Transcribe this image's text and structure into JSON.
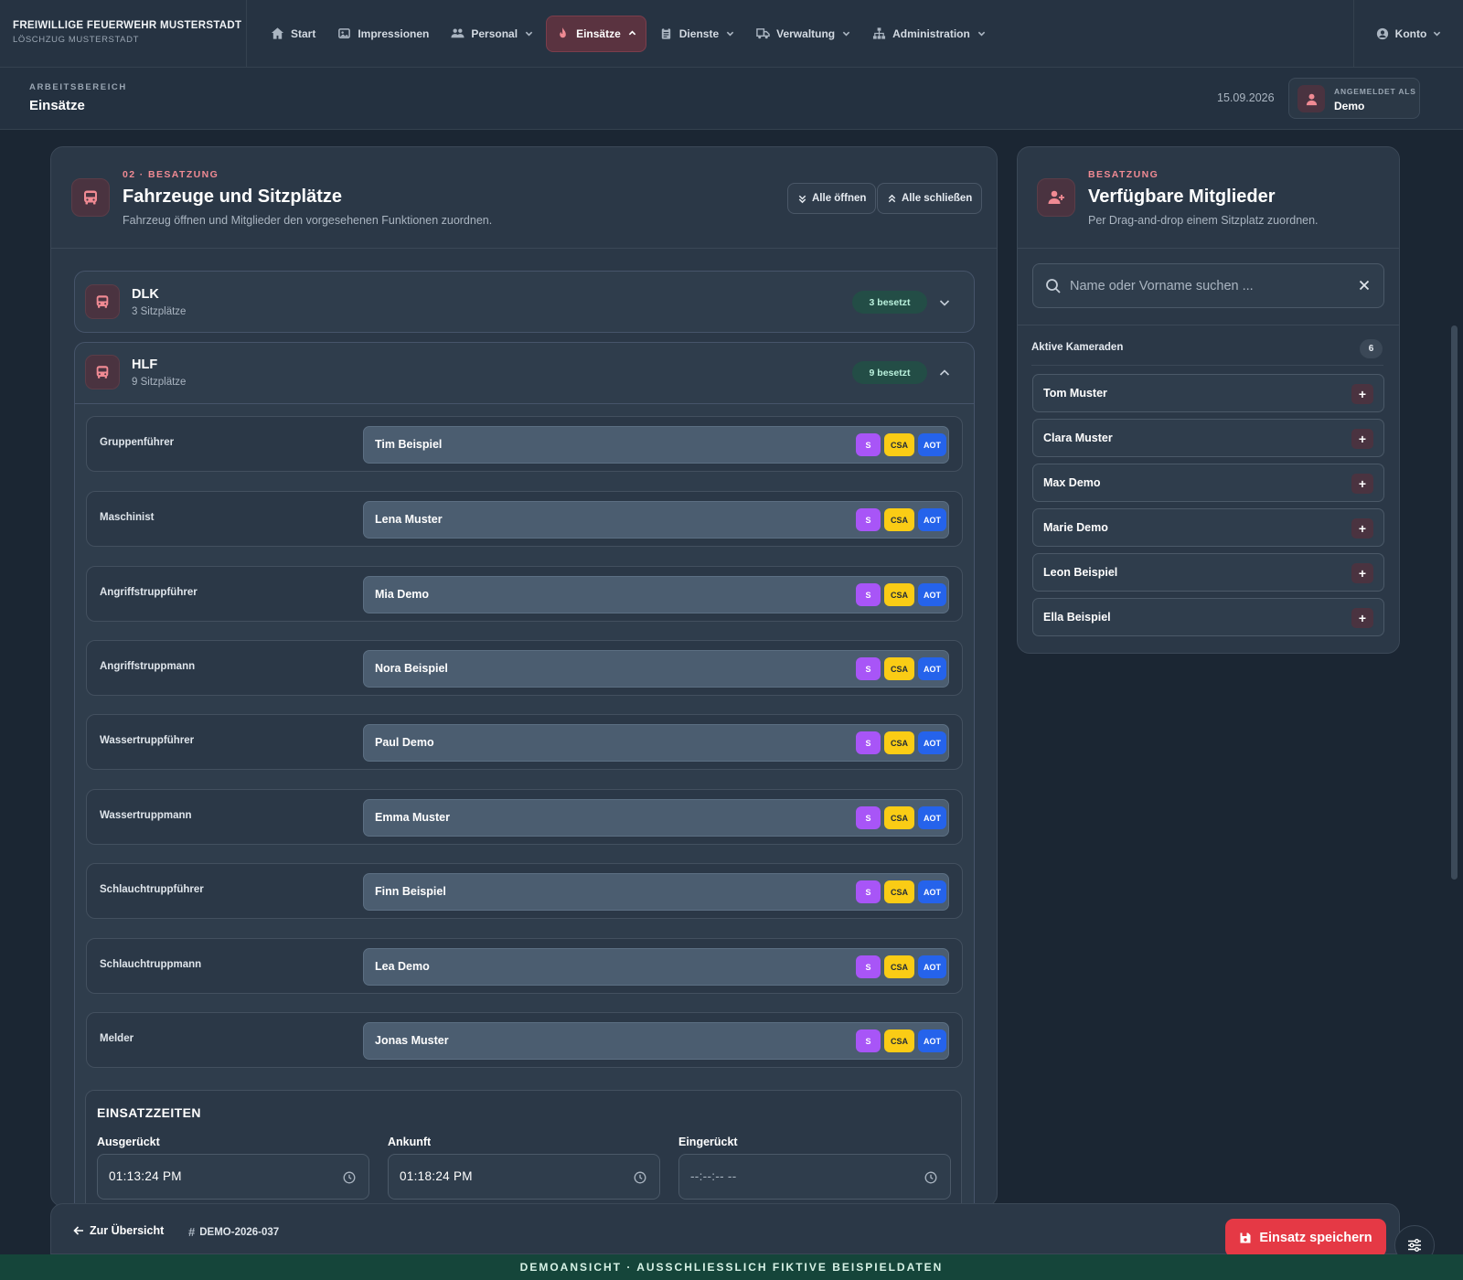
{
  "brand": {
    "title": "FREIWILLIGE FEUERWEHR MUSTERSTADT",
    "subtitle": "LÖSCHZUG MUSTERSTADT"
  },
  "nav": {
    "items": [
      {
        "label": "Start",
        "icon": "home-icon"
      },
      {
        "label": "Impressionen",
        "icon": "image-icon"
      },
      {
        "label": "Personal",
        "icon": "users-icon"
      },
      {
        "label": "Einsätze",
        "icon": "flame-icon"
      },
      {
        "label": "Dienste",
        "icon": "clipboard-icon"
      },
      {
        "label": "Verwaltung",
        "icon": "truck-icon"
      },
      {
        "label": "Administration",
        "icon": "network-icon"
      }
    ],
    "active": "Einsätze",
    "account_label": "Konto"
  },
  "subheader": {
    "kicker": "ARBEITSBEREICH",
    "title": "Einsätze",
    "date": "15.09.2026",
    "user_label": "ANGEMELDET ALS",
    "user_name": "Demo"
  },
  "vehicles_panel": {
    "kicker": "02 · BESATZUNG",
    "title": "Fahrzeuge und Sitzplätze",
    "subtitle": "Fahrzeug öffnen und Mitglieder den vorgesehenen Funktionen zuordnen.",
    "open_all": "Alle öffnen",
    "close_all": "Alle schließen",
    "vehicles": [
      {
        "name": "DLK",
        "seats": "3 Sitzplätze",
        "badge": "3 besetzt",
        "expanded": false
      },
      {
        "name": "HLF",
        "seats": "9 Sitzplätze",
        "badge": "9 besetzt",
        "expanded": true
      }
    ],
    "tags": {
      "s": "S",
      "csa": "CSA",
      "aot": "AOT"
    },
    "assignments": [
      {
        "role": "Gruppenführer",
        "person": "Tim Beispiel"
      },
      {
        "role": "Maschinist",
        "person": "Lena Muster"
      },
      {
        "role": "Angriffstruppführer",
        "person": "Mia Demo"
      },
      {
        "role": "Angriffstruppmann",
        "person": "Nora Beispiel"
      },
      {
        "role": "Wassertruppführer",
        "person": "Paul Demo"
      },
      {
        "role": "Wassertruppmann",
        "person": "Emma Muster"
      },
      {
        "role": "Schlauchtruppführer",
        "person": "Finn Beispiel"
      },
      {
        "role": "Schlauchtruppmann",
        "person": "Lea Demo"
      },
      {
        "role": "Melder",
        "person": "Jonas Muster"
      }
    ],
    "times": {
      "title": "EINSATZZEITEN",
      "fields": [
        {
          "label": "Ausgerückt",
          "value": "01:13:24 PM"
        },
        {
          "label": "Ankunft",
          "value": "01:18:24 PM"
        },
        {
          "label": "Eingerückt",
          "value": "--:--:-- --"
        }
      ]
    }
  },
  "members_panel": {
    "kicker": "BESATZUNG",
    "title": "Verfügbare Mitglieder",
    "subtitle": "Per Drag-and-drop einem Sitzplatz zuordnen.",
    "search_placeholder": "Name oder Vorname suchen ...",
    "active_label": "Aktive Kameraden",
    "active_count": "6",
    "add_symbol": "+",
    "members": [
      "Tom Muster",
      "Clara Muster",
      "Max Demo",
      "Marie Demo",
      "Leon Beispiel",
      "Ella Beispiel"
    ]
  },
  "footer": {
    "back_label": "Zur Übersicht",
    "ref_hash": "#",
    "ref": "DEMO-2026-037",
    "save_label": "Einsatz speichern"
  },
  "banner": "DEMOANSICHT · AUSSCHLIESSLICH FIKTIVE BEISPIELDATEN",
  "colors": {
    "accent": "#e53945",
    "accent_soft": "#f08a93",
    "tag_s": "#a855f7",
    "tag_csa": "#facc15",
    "tag_aot": "#2563eb",
    "badge_green": "#234d46",
    "banner": "#15453a"
  }
}
